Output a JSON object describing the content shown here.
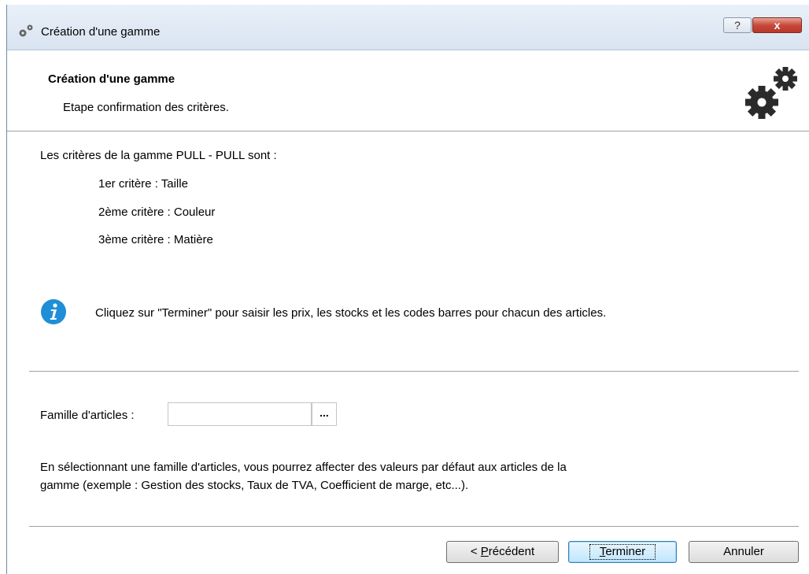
{
  "window": {
    "title": "Création d'une gamme",
    "help_label": "?",
    "close_label": "x"
  },
  "header": {
    "title": "Création d'une gamme",
    "subtitle": "Etape confirmation des critères."
  },
  "content": {
    "intro": "Les critères de la gamme PULL - PULL sont :",
    "criteria": [
      "1er critère :  Taille",
      "2ème critère :  Couleur",
      "3ème critère :  Matière"
    ],
    "info_text": "Cliquez sur \"Terminer\" pour saisir les prix, les stocks et les codes barres pour chacun des articles.",
    "famille_label": "Famille d'articles :",
    "famille_value": "",
    "famille_browse": "...",
    "note_line1": "En sélectionnant une famille d'articles, vous pourrez affecter des valeurs par défaut aux articles de la",
    "note_line2": "gamme (exemple : Gestion des stocks, Taux de TVA, Coefficient de marge, etc...)."
  },
  "buttons": {
    "prev_prefix": "< ",
    "prev_mnemonic": "P",
    "prev_rest": "récédent",
    "finish_mnemonic": "T",
    "finish_rest": "erminer",
    "cancel": "Annuler"
  },
  "colors": {
    "info_blue": "#1e8fd6",
    "gear_dark": "#2b2b2b"
  }
}
